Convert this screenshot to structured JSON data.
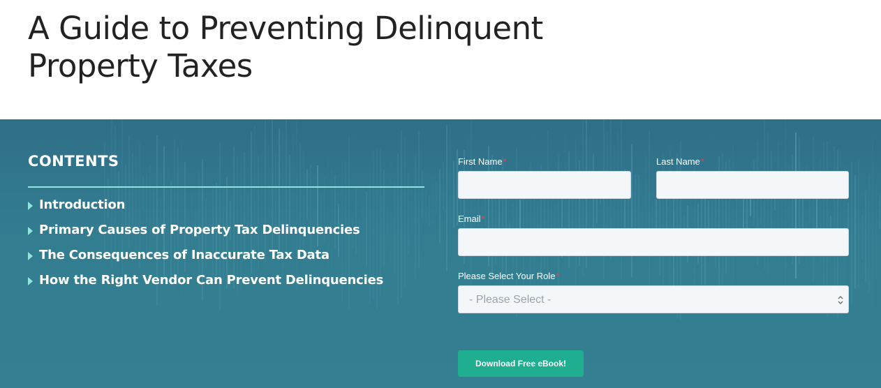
{
  "page": {
    "title": "A Guide to Preventing Delinquent Property Taxes"
  },
  "contents": {
    "heading": "CONTENTS",
    "items": [
      {
        "label": "Introduction"
      },
      {
        "label": "Primary Causes of Property Tax Delinquencies"
      },
      {
        "label": "The Consequences of Inaccurate Tax Data"
      },
      {
        "label": "How the Right Vendor Can Prevent Delinquencies"
      }
    ],
    "bullet_icon": "triangle-right-icon"
  },
  "form": {
    "first_name": {
      "label": "First Name",
      "required_mark": "*",
      "value": ""
    },
    "last_name": {
      "label": "Last Name",
      "required_mark": "*",
      "value": ""
    },
    "email": {
      "label": "Email",
      "required_mark": "*",
      "value": ""
    },
    "role": {
      "label": "Please Select Your Role",
      "required_mark": "*",
      "selected": "- Please Select -",
      "icon": "chevron-updown-icon"
    },
    "submit_label": "Download Free eBook!"
  },
  "colors": {
    "hero_background": "#337d91",
    "accent_rule": "#8fe6dc",
    "required_asterisk": "#e5484d",
    "button": "#1fae8f",
    "input_background": "#f4f7fa",
    "title_text": "#222222"
  }
}
